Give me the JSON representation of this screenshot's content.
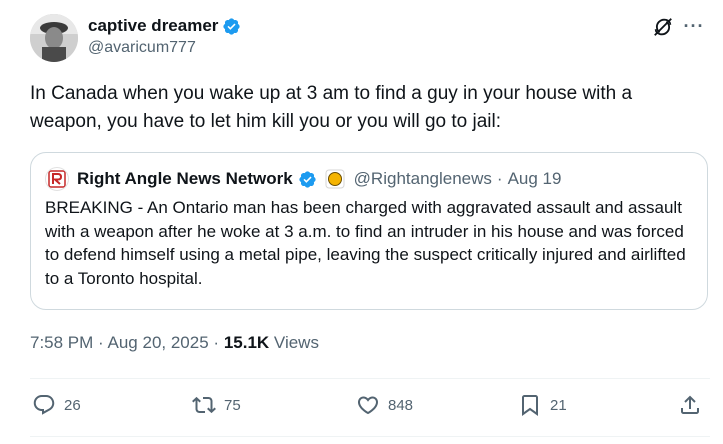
{
  "author": {
    "display_name": "captive dreamer",
    "handle": "@avaricum777",
    "verified": true
  },
  "icons": {
    "grok": "grok-icon",
    "more": "more-options-icon"
  },
  "tweet": {
    "text": "In Canada when you wake up at 3 am to find a guy in your house with a weapon, you have to let him kill you or you will go to jail:"
  },
  "quoted_tweet": {
    "display_name": "Right Angle News Network",
    "handle": "@Rightanglenews",
    "separator": "·",
    "date": "Aug 19",
    "text": "BREAKING - An Ontario man has been charged with aggravated assault and assault with a weapon after he woke at 3 a.m. to find an intruder in his house and was forced to defend himself using a metal pipe, leaving the suspect critically injured and airlifted to a Toronto hospital."
  },
  "meta": {
    "time": "7:58 PM",
    "separator": "·",
    "date": "Aug 20, 2025",
    "views_count": "15.1K",
    "views_label": "Views"
  },
  "actions": {
    "replies": "26",
    "reposts": "75",
    "likes": "848",
    "bookmarks": "21"
  },
  "colors": {
    "verified_blue": "#1d9bf0",
    "text_primary": "#0f1419",
    "text_secondary": "#536471",
    "border": "#cfd9de",
    "affiliate_gold": "#f5b400"
  }
}
